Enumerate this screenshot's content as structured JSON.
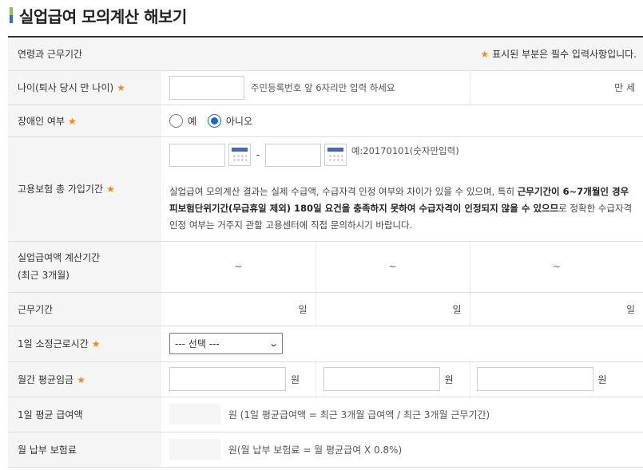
{
  "page": {
    "title": "실업급여 모의계산 해보기",
    "brand_colors": {
      "green": "#8bc34a",
      "blue": "#2e6fd0",
      "required": "#f08d1a"
    }
  },
  "form": {
    "header": {
      "label": "연령과 근무기간",
      "required_note": "표시된 부분은 필수 입력사항입니다.",
      "star": "★"
    },
    "age": {
      "label": "나이(퇴사 당시 만 나이)",
      "value": "",
      "hint": "주민등록번호 앞 6자리만 입력 하세요",
      "unit": "만 세"
    },
    "disabled": {
      "label": "장애인 여부",
      "options": [
        "예",
        "아니오"
      ],
      "selected": "아니오"
    },
    "insurance": {
      "label": "고용보험 총 가입기간",
      "start_value": "",
      "end_value": "",
      "separator": "-",
      "example": "예:20170101(숫자만입력)",
      "note_1": "실업급여 모의계산 결과는 실제 수급액, 수급자격 인정 여부와 차이가 있을 수 있으며, 특히 ",
      "note_bold": "근무기간이 6~7개월인 경우 피보험단위기간(무급휴일 제외) 180일 요건을 충족하지 못하여 수급자격이 인정되지 않을 수 있으므",
      "note_2": "로 정확한 수급자격 인정 여부는 거주지 관할 고용센터에 직접 문의하시기 바랍니다."
    },
    "calc_period": {
      "label_line1": "실업급여액 계산기간",
      "label_line2": "(최근 3개월)",
      "periods": [
        "~",
        "~",
        "~"
      ]
    },
    "work_period": {
      "label": "근무기간",
      "days": [
        "일",
        "일",
        "일"
      ]
    },
    "daily_hours": {
      "label": "1일 소정근로시간",
      "selected": "--- 선택 ---"
    },
    "monthly_wage": {
      "label": "월간 평균임금",
      "values": [
        "",
        "",
        ""
      ],
      "unit": "원"
    },
    "daily_benefit": {
      "label": "1일 평균 급여액",
      "value": "",
      "formula": "원 (1일 평균급여액 = 최근 3개월 급여액 / 최근 3개월 근무기간)"
    },
    "monthly_premium": {
      "label": "월 납부 보험료",
      "value": "",
      "formula": "원(월 납부 보험료 = 월 평균급여 X 0.8%)"
    }
  }
}
